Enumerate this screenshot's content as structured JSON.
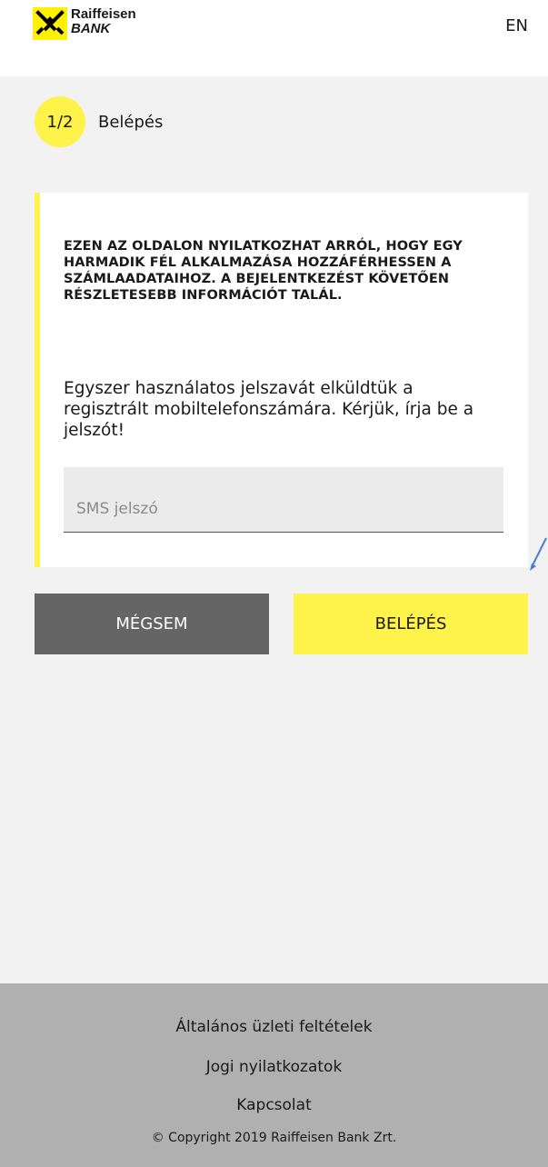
{
  "header": {
    "logo_line1": "Raiffeisen",
    "logo_line2": "BANK",
    "logo_icon": "raiffeisen-gable-cross-icon",
    "language": "EN"
  },
  "step": {
    "badge": "1/2",
    "label": "Belépés"
  },
  "card": {
    "notice": "EZEN AZ OLDALON NYILATKOZHAT ARRÓL, HOGY EGY HARMADIK FÉL ALKALMAZÁSA HOZZÁFÉRHESSEN A SZÁMLAADATAIHOZ. A BEJELENTKEZÉST KÖVETŐEN RÉSZLETESEBB INFORMÁCIÓT TALÁL.",
    "info": "Egyszer használatos jelszavát elküldtük a regisztrált mobiltelefonszámára. Kérjük, írja be a jelszót!",
    "sms_input": {
      "placeholder": "SMS jelszó",
      "value": ""
    }
  },
  "buttons": {
    "cancel_label": "MÉGSEM",
    "login_label": "BELÉPÉS"
  },
  "footer": {
    "links": [
      "Általános üzleti feltételek",
      "Jogi nyilatkozatok",
      "Kapcsolat"
    ],
    "copyright": "© Copyright 2019 Raiffeisen Bank Zrt."
  },
  "colors": {
    "brand_yellow": "#fff24a",
    "cancel_gray": "#656565",
    "footer_gray": "#b0b0b0",
    "page_bg": "#f2f2f2"
  }
}
